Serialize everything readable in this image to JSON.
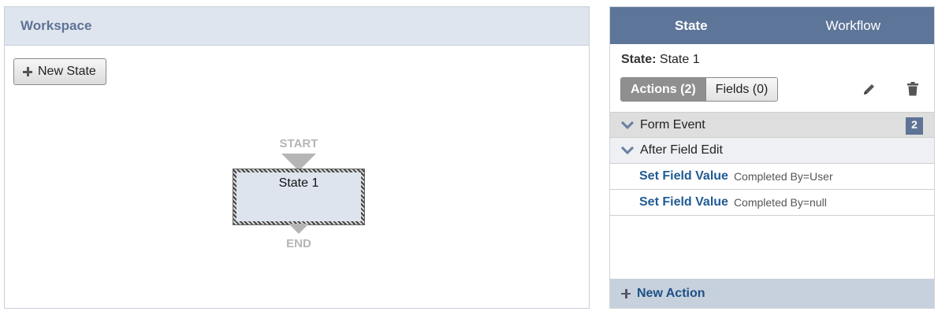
{
  "workspace": {
    "title": "Workspace",
    "new_state_label": "New State",
    "start_label": "START",
    "end_label": "END",
    "state_node_label": "State 1"
  },
  "panel": {
    "tabs": [
      {
        "label": "State",
        "active": true
      },
      {
        "label": "Workflow",
        "active": false
      }
    ],
    "state_prefix": "State:",
    "state_name": "State 1",
    "segments": {
      "actions_label": "Actions (2)",
      "fields_label": "Fields (0)",
      "active": "actions"
    },
    "sections": [
      {
        "label": "Form Event",
        "badge": "2"
      },
      {
        "label": "After Field Edit"
      }
    ],
    "actions": [
      {
        "name": "Set Field Value",
        "detail": "Completed By=User"
      },
      {
        "name": "Set Field Value",
        "detail": "Completed By=null"
      }
    ],
    "new_action_label": "New Action"
  },
  "colors": {
    "header_bg": "#dfe5ee",
    "tab_bar": "#5d7598",
    "link": "#1f5b93",
    "badge": "#5f7396",
    "footer_bg": "#c6d1dd"
  },
  "icons": [
    "plus-icon",
    "pencil-icon",
    "trash-icon",
    "chevron-down-icon"
  ]
}
